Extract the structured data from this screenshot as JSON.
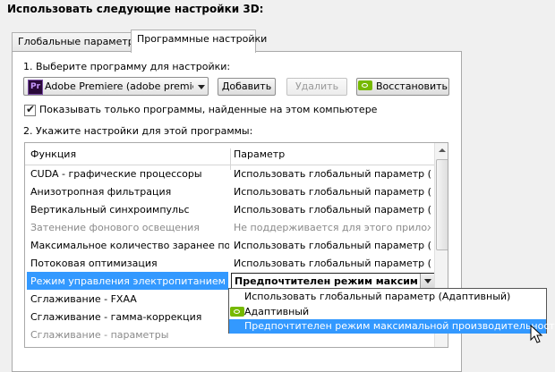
{
  "heading": "Использовать следующие настройки 3D:",
  "tabs": [
    {
      "label": "Глобальные параметры",
      "active": false
    },
    {
      "label": "Программные настройки",
      "active": true
    }
  ],
  "step1": {
    "label": "1. Выберите программу для настройки:",
    "program_icon": "Pr",
    "program_value": "Adobe Premiere (adobe premier...",
    "add_button": "Добавить",
    "remove_button": "Удалить",
    "restore_button": "Восстановить"
  },
  "filter_checkbox": {
    "label": "Показывать только программы, найденные на этом компьютере",
    "checked": true
  },
  "step2": {
    "label": "2. Укажите настройки для этой программы:"
  },
  "grid": {
    "col_function": "Функция",
    "col_parameter": "Параметр",
    "rows": [
      {
        "function": "CUDA - графические процессоры",
        "parameter": "Использовать глобальный параметр (G..."
      },
      {
        "function": "Анизотропная фильтрация",
        "parameter": "Использовать глобальный параметр (У..."
      },
      {
        "function": "Вертикальный синхроимпульс",
        "parameter": "Использовать глобальный параметр (И..."
      },
      {
        "function": "Затенение фонового освещения",
        "parameter": "Не поддерживается для этого приложе..."
      },
      {
        "function": "Максимальное количество заранее под...",
        "parameter": "Использовать глобальный параметр (И..."
      },
      {
        "function": "Потоковая оптимизация",
        "parameter": "Использовать глобальный параметр (А..."
      },
      {
        "function": "Режим управления электропитанием",
        "parameter": "Предпочтителен режим максималь"
      },
      {
        "function": "Сглаживание - FXAA",
        "parameter": ""
      },
      {
        "function": "Сглаживание - гамма-коррекция",
        "parameter": ""
      },
      {
        "function": "Сглаживание - параметры",
        "parameter": ""
      }
    ]
  },
  "dropdown_options": [
    "Использовать глобальный параметр (Адаптивный)",
    "Адаптивный",
    "Предпочтителен режим максимальной производительности"
  ],
  "colors": {
    "selection": "#3399ff",
    "nvidia_green": "#76b900",
    "disabled_text": "#8a8a8a"
  }
}
